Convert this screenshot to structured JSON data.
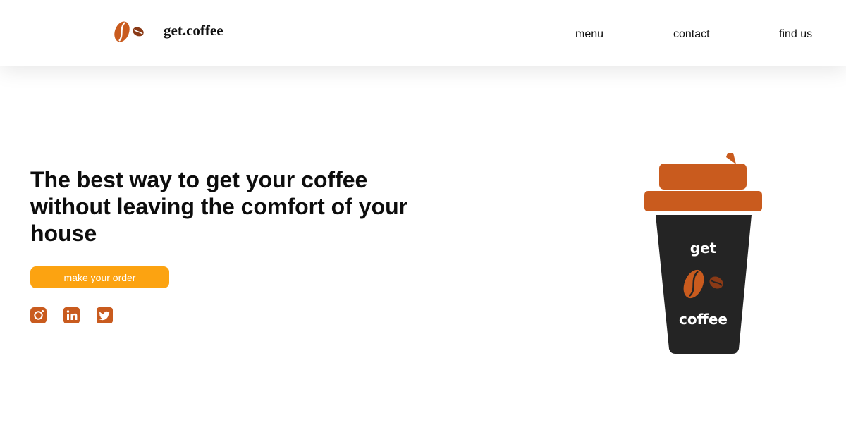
{
  "header": {
    "brand_name": "get.coffee",
    "logo_icon": "coffee-beans-icon",
    "nav": [
      {
        "label": "menu"
      },
      {
        "label": "contact"
      },
      {
        "label": "find us"
      }
    ]
  },
  "hero": {
    "title": "The best way to get your coffee without leaving the comfort of your house",
    "cta_label": "make your order",
    "social_icons": [
      "instagram-icon",
      "linkedin-icon",
      "twitter-icon"
    ]
  },
  "cup": {
    "text_top": "get",
    "text_bottom": "coffee"
  },
  "colors": {
    "accent": "#fca311",
    "brand_brown": "#c95b1e",
    "bean_dark": "#8a3a16",
    "cup_body": "#242424"
  }
}
